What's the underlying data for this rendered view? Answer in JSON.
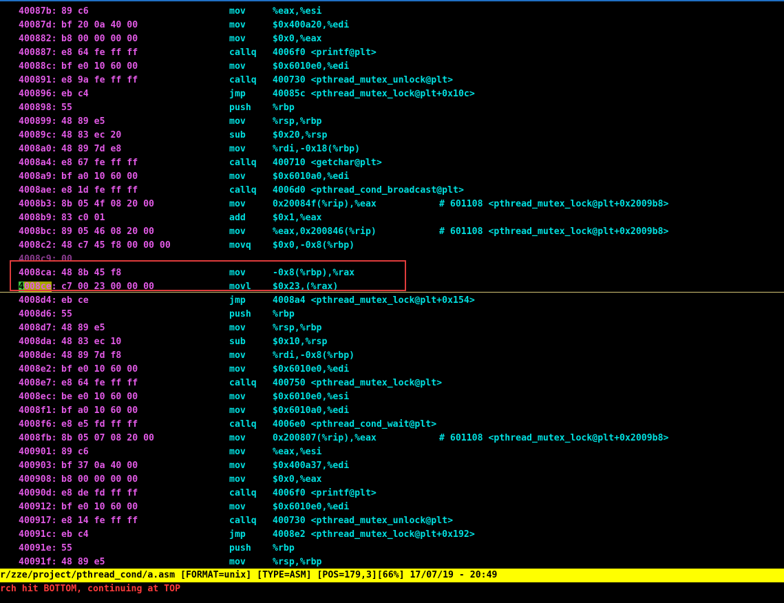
{
  "colors": {
    "background": "#000000",
    "address": "#e25ae6",
    "mnemonic": "#00e0e0",
    "status_bar_bg": "#ffff00",
    "message": "#ff3b3b",
    "selection_box": "#e03c3c"
  },
  "lines": [
    {
      "addr": "40087b:",
      "bytes": "89 c6",
      "mn": "mov",
      "ops": "%eax,%esi",
      "cmt": ""
    },
    {
      "addr": "40087d:",
      "bytes": "bf 20 0a 40 00",
      "mn": "mov",
      "ops": "$0x400a20,%edi",
      "cmt": ""
    },
    {
      "addr": "400882:",
      "bytes": "b8 00 00 00 00",
      "mn": "mov",
      "ops": "$0x0,%eax",
      "cmt": ""
    },
    {
      "addr": "400887:",
      "bytes": "e8 64 fe ff ff",
      "mn": "callq",
      "ops": "4006f0 <printf@plt>",
      "cmt": ""
    },
    {
      "addr": "40088c:",
      "bytes": "bf e0 10 60 00",
      "mn": "mov",
      "ops": "$0x6010e0,%edi",
      "cmt": ""
    },
    {
      "addr": "400891:",
      "bytes": "e8 9a fe ff ff",
      "mn": "callq",
      "ops": "400730 <pthread_mutex_unlock@plt>",
      "cmt": ""
    },
    {
      "addr": "400896:",
      "bytes": "eb c4",
      "mn": "jmp",
      "ops": "40085c <pthread_mutex_lock@plt+0x10c>",
      "cmt": ""
    },
    {
      "addr": "400898:",
      "bytes": "55",
      "mn": "push",
      "ops": "%rbp",
      "cmt": ""
    },
    {
      "addr": "400899:",
      "bytes": "48 89 e5",
      "mn": "mov",
      "ops": "%rsp,%rbp",
      "cmt": ""
    },
    {
      "addr": "40089c:",
      "bytes": "48 83 ec 20",
      "mn": "sub",
      "ops": "$0x20,%rsp",
      "cmt": ""
    },
    {
      "addr": "4008a0:",
      "bytes": "48 89 7d e8",
      "mn": "mov",
      "ops": "%rdi,-0x18(%rbp)",
      "cmt": ""
    },
    {
      "addr": "4008a4:",
      "bytes": "e8 67 fe ff ff",
      "mn": "callq",
      "ops": "400710 <getchar@plt>",
      "cmt": ""
    },
    {
      "addr": "4008a9:",
      "bytes": "bf a0 10 60 00",
      "mn": "mov",
      "ops": "$0x6010a0,%edi",
      "cmt": ""
    },
    {
      "addr": "4008ae:",
      "bytes": "e8 1d fe ff ff",
      "mn": "callq",
      "ops": "4006d0 <pthread_cond_broadcast@plt>",
      "cmt": ""
    },
    {
      "addr": "4008b3:",
      "bytes": "8b 05 4f 08 20 00",
      "mn": "mov",
      "ops": "0x20084f(%rip),%eax",
      "cmt": "# 601108 <pthread_mutex_lock@plt+0x2009b8>"
    },
    {
      "addr": "4008b9:",
      "bytes": "83 c0 01",
      "mn": "add",
      "ops": "$0x1,%eax",
      "cmt": ""
    },
    {
      "addr": "4008bc:",
      "bytes": "89 05 46 08 20 00",
      "mn": "mov",
      "ops": "%eax,0x200846(%rip)",
      "cmt": "# 601108 <pthread_mutex_lock@plt+0x2009b8>"
    },
    {
      "addr": "4008c2:",
      "bytes": "48 c7 45 f8 00 00 00",
      "mn": "movq",
      "ops": "$0x0,-0x8(%rbp)",
      "cmt": ""
    },
    {
      "addr": "4008c9:",
      "bytes": "00",
      "mn": "",
      "ops": "",
      "cmt": ""
    },
    {
      "addr": "4008ca:",
      "bytes": "48 8b 45 f8",
      "mn": "mov",
      "ops": "-0x8(%rbp),%rax",
      "cmt": ""
    },
    {
      "addr": "4008ce:",
      "bytes": "c7 00 23 00 00 00",
      "mn": "movl",
      "ops": "$0x23,(%rax)",
      "cmt": ""
    },
    {
      "addr": "4008d4:",
      "bytes": "eb ce",
      "mn": "jmp",
      "ops": "4008a4 <pthread_mutex_lock@plt+0x154>",
      "cmt": ""
    },
    {
      "addr": "4008d6:",
      "bytes": "55",
      "mn": "push",
      "ops": "%rbp",
      "cmt": ""
    },
    {
      "addr": "4008d7:",
      "bytes": "48 89 e5",
      "mn": "mov",
      "ops": "%rsp,%rbp",
      "cmt": ""
    },
    {
      "addr": "4008da:",
      "bytes": "48 83 ec 10",
      "mn": "sub",
      "ops": "$0x10,%rsp",
      "cmt": ""
    },
    {
      "addr": "4008de:",
      "bytes": "48 89 7d f8",
      "mn": "mov",
      "ops": "%rdi,-0x8(%rbp)",
      "cmt": ""
    },
    {
      "addr": "4008e2:",
      "bytes": "bf e0 10 60 00",
      "mn": "mov",
      "ops": "$0x6010e0,%edi",
      "cmt": ""
    },
    {
      "addr": "4008e7:",
      "bytes": "e8 64 fe ff ff",
      "mn": "callq",
      "ops": "400750 <pthread_mutex_lock@plt>",
      "cmt": ""
    },
    {
      "addr": "4008ec:",
      "bytes": "be e0 10 60 00",
      "mn": "mov",
      "ops": "$0x6010e0,%esi",
      "cmt": ""
    },
    {
      "addr": "4008f1:",
      "bytes": "bf a0 10 60 00",
      "mn": "mov",
      "ops": "$0x6010a0,%edi",
      "cmt": ""
    },
    {
      "addr": "4008f6:",
      "bytes": "e8 e5 fd ff ff",
      "mn": "callq",
      "ops": "4006e0 <pthread_cond_wait@plt>",
      "cmt": ""
    },
    {
      "addr": "4008fb:",
      "bytes": "8b 05 07 08 20 00",
      "mn": "mov",
      "ops": "0x200807(%rip),%eax",
      "cmt": "# 601108 <pthread_mutex_lock@plt+0x2009b8>"
    },
    {
      "addr": "400901:",
      "bytes": "89 c6",
      "mn": "mov",
      "ops": "%eax,%esi",
      "cmt": ""
    },
    {
      "addr": "400903:",
      "bytes": "bf 37 0a 40 00",
      "mn": "mov",
      "ops": "$0x400a37,%edi",
      "cmt": ""
    },
    {
      "addr": "400908:",
      "bytes": "b8 00 00 00 00",
      "mn": "mov",
      "ops": "$0x0,%eax",
      "cmt": ""
    },
    {
      "addr": "40090d:",
      "bytes": "e8 de fd ff ff",
      "mn": "callq",
      "ops": "4006f0 <printf@plt>",
      "cmt": ""
    },
    {
      "addr": "400912:",
      "bytes": "bf e0 10 60 00",
      "mn": "mov",
      "ops": "$0x6010e0,%edi",
      "cmt": ""
    },
    {
      "addr": "400917:",
      "bytes": "e8 14 fe ff ff",
      "mn": "callq",
      "ops": "400730 <pthread_mutex_unlock@plt>",
      "cmt": ""
    },
    {
      "addr": "40091c:",
      "bytes": "eb c4",
      "mn": "jmp",
      "ops": "4008e2 <pthread_mutex_lock@plt+0x192>",
      "cmt": ""
    },
    {
      "addr": "40091e:",
      "bytes": "55",
      "mn": "push",
      "ops": "%rbp",
      "cmt": ""
    },
    {
      "addr": "40091f:",
      "bytes": "48 89 e5",
      "mn": "mov",
      "ops": "%rsp,%rbp",
      "cmt": ""
    }
  ],
  "cursor_line_index": 20,
  "partial_line_index": 18,
  "status_bar": {
    "text": "r/zze/project/pthread_cond/a.asm [FORMAT=unix] [TYPE=ASM] [POS=179,3][66%] 17/07/19 - 20:49"
  },
  "message": {
    "text": "rch hit BOTTOM, continuing at TOP"
  }
}
